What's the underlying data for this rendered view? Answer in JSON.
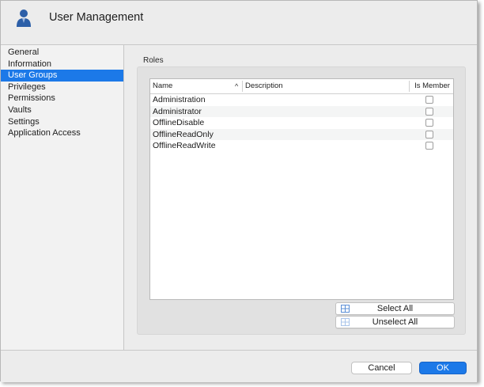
{
  "window": {
    "title": "User Management",
    "accent_color": "#1c79e8"
  },
  "sidebar": {
    "items": [
      {
        "label": "General",
        "selected": false
      },
      {
        "label": "Information",
        "selected": false
      },
      {
        "label": "User Groups",
        "selected": true
      },
      {
        "label": "Privileges",
        "selected": false
      },
      {
        "label": "Permissions",
        "selected": false
      },
      {
        "label": "Vaults",
        "selected": false
      },
      {
        "label": "Settings",
        "selected": false
      },
      {
        "label": "Application Access",
        "selected": false
      }
    ]
  },
  "roles": {
    "section_label": "Roles",
    "columns": {
      "name": "Name",
      "description": "Description",
      "is_member": "Is Member"
    },
    "sort_indicator": "^",
    "rows": [
      {
        "name": "Administration",
        "description": "",
        "is_member": false
      },
      {
        "name": "Administrator",
        "description": "",
        "is_member": false
      },
      {
        "name": "OfflineDisable",
        "description": "",
        "is_member": false
      },
      {
        "name": "OfflineReadOnly",
        "description": "",
        "is_member": false
      },
      {
        "name": "OfflineReadWrite",
        "description": "",
        "is_member": false
      }
    ],
    "select_all_label": "Select All",
    "unselect_all_label": "Unselect All"
  },
  "footer": {
    "cancel_label": "Cancel",
    "ok_label": "OK"
  },
  "icons": {
    "header": "user-icon",
    "select_all": "grid-select-icon",
    "unselect_all": "grid-unselect-icon"
  }
}
